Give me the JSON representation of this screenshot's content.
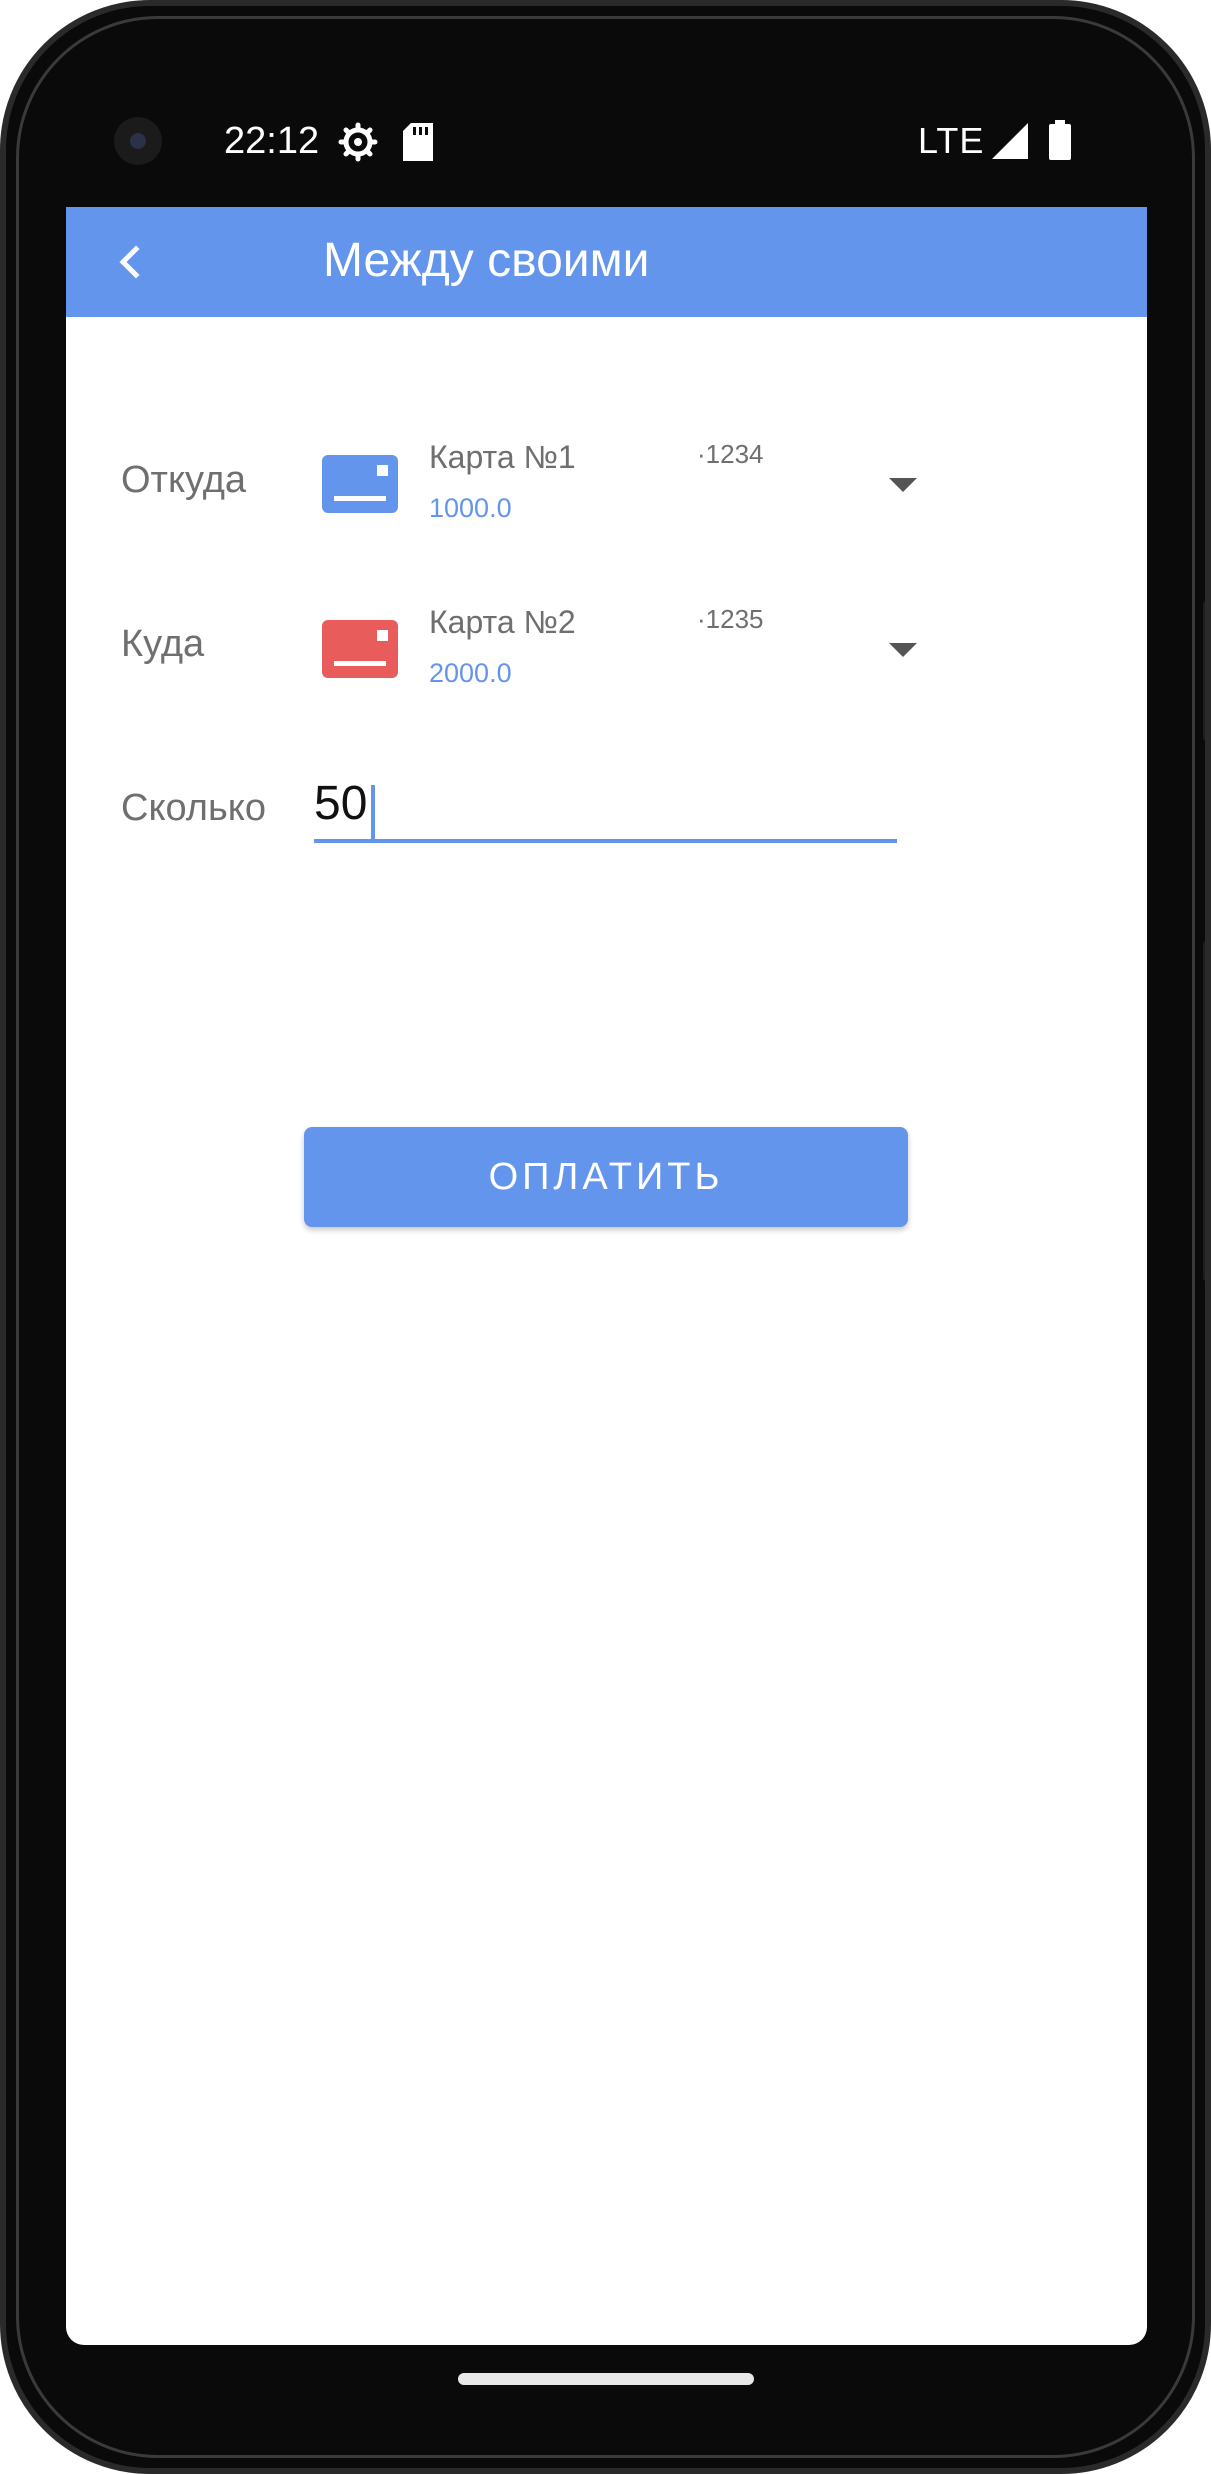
{
  "status_bar": {
    "time": "22:12",
    "network": "LTE",
    "icons": [
      "settings-gear-icon",
      "sd-card-icon",
      "signal-icon",
      "battery-icon"
    ]
  },
  "app_bar": {
    "title": "Между своими",
    "back_icon": "chevron-left-icon",
    "color": "#6495ec"
  },
  "form": {
    "from": {
      "label": "Откуда",
      "card_name": "Карта №1",
      "card_mask": "·1234",
      "balance": "1000.0",
      "card_color": "#6495ec"
    },
    "to": {
      "label": "Куда",
      "card_name": "Карта №2",
      "card_mask": "·1235",
      "balance": "2000.0",
      "card_color": "#e85c5c"
    },
    "amount": {
      "label": "Сколько",
      "value": "50"
    }
  },
  "actions": {
    "pay_label": "ОПЛАТИТЬ"
  },
  "colors": {
    "accent": "#6495ec",
    "balance_text": "#6495ec",
    "label_text": "#6f6f6f"
  }
}
